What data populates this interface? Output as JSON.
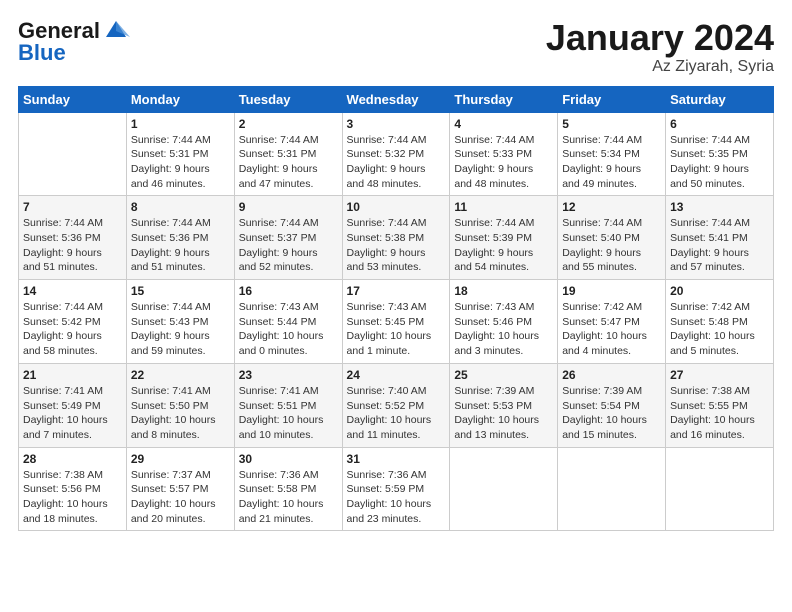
{
  "header": {
    "logo_line1": "General",
    "logo_line2": "Blue",
    "month_title": "January 2024",
    "subtitle": "Az Ziyarah, Syria"
  },
  "days_of_week": [
    "Sunday",
    "Monday",
    "Tuesday",
    "Wednesday",
    "Thursday",
    "Friday",
    "Saturday"
  ],
  "weeks": [
    [
      {
        "day": "",
        "sunrise": "",
        "sunset": "",
        "daylight": ""
      },
      {
        "day": "1",
        "sunrise": "Sunrise: 7:44 AM",
        "sunset": "Sunset: 5:31 PM",
        "daylight": "Daylight: 9 hours and 46 minutes."
      },
      {
        "day": "2",
        "sunrise": "Sunrise: 7:44 AM",
        "sunset": "Sunset: 5:31 PM",
        "daylight": "Daylight: 9 hours and 47 minutes."
      },
      {
        "day": "3",
        "sunrise": "Sunrise: 7:44 AM",
        "sunset": "Sunset: 5:32 PM",
        "daylight": "Daylight: 9 hours and 48 minutes."
      },
      {
        "day": "4",
        "sunrise": "Sunrise: 7:44 AM",
        "sunset": "Sunset: 5:33 PM",
        "daylight": "Daylight: 9 hours and 48 minutes."
      },
      {
        "day": "5",
        "sunrise": "Sunrise: 7:44 AM",
        "sunset": "Sunset: 5:34 PM",
        "daylight": "Daylight: 9 hours and 49 minutes."
      },
      {
        "day": "6",
        "sunrise": "Sunrise: 7:44 AM",
        "sunset": "Sunset: 5:35 PM",
        "daylight": "Daylight: 9 hours and 50 minutes."
      }
    ],
    [
      {
        "day": "7",
        "sunrise": "Sunrise: 7:44 AM",
        "sunset": "Sunset: 5:36 PM",
        "daylight": "Daylight: 9 hours and 51 minutes."
      },
      {
        "day": "8",
        "sunrise": "Sunrise: 7:44 AM",
        "sunset": "Sunset: 5:36 PM",
        "daylight": "Daylight: 9 hours and 51 minutes."
      },
      {
        "day": "9",
        "sunrise": "Sunrise: 7:44 AM",
        "sunset": "Sunset: 5:37 PM",
        "daylight": "Daylight: 9 hours and 52 minutes."
      },
      {
        "day": "10",
        "sunrise": "Sunrise: 7:44 AM",
        "sunset": "Sunset: 5:38 PM",
        "daylight": "Daylight: 9 hours and 53 minutes."
      },
      {
        "day": "11",
        "sunrise": "Sunrise: 7:44 AM",
        "sunset": "Sunset: 5:39 PM",
        "daylight": "Daylight: 9 hours and 54 minutes."
      },
      {
        "day": "12",
        "sunrise": "Sunrise: 7:44 AM",
        "sunset": "Sunset: 5:40 PM",
        "daylight": "Daylight: 9 hours and 55 minutes."
      },
      {
        "day": "13",
        "sunrise": "Sunrise: 7:44 AM",
        "sunset": "Sunset: 5:41 PM",
        "daylight": "Daylight: 9 hours and 57 minutes."
      }
    ],
    [
      {
        "day": "14",
        "sunrise": "Sunrise: 7:44 AM",
        "sunset": "Sunset: 5:42 PM",
        "daylight": "Daylight: 9 hours and 58 minutes."
      },
      {
        "day": "15",
        "sunrise": "Sunrise: 7:44 AM",
        "sunset": "Sunset: 5:43 PM",
        "daylight": "Daylight: 9 hours and 59 minutes."
      },
      {
        "day": "16",
        "sunrise": "Sunrise: 7:43 AM",
        "sunset": "Sunset: 5:44 PM",
        "daylight": "Daylight: 10 hours and 0 minutes."
      },
      {
        "day": "17",
        "sunrise": "Sunrise: 7:43 AM",
        "sunset": "Sunset: 5:45 PM",
        "daylight": "Daylight: 10 hours and 1 minute."
      },
      {
        "day": "18",
        "sunrise": "Sunrise: 7:43 AM",
        "sunset": "Sunset: 5:46 PM",
        "daylight": "Daylight: 10 hours and 3 minutes."
      },
      {
        "day": "19",
        "sunrise": "Sunrise: 7:42 AM",
        "sunset": "Sunset: 5:47 PM",
        "daylight": "Daylight: 10 hours and 4 minutes."
      },
      {
        "day": "20",
        "sunrise": "Sunrise: 7:42 AM",
        "sunset": "Sunset: 5:48 PM",
        "daylight": "Daylight: 10 hours and 5 minutes."
      }
    ],
    [
      {
        "day": "21",
        "sunrise": "Sunrise: 7:41 AM",
        "sunset": "Sunset: 5:49 PM",
        "daylight": "Daylight: 10 hours and 7 minutes."
      },
      {
        "day": "22",
        "sunrise": "Sunrise: 7:41 AM",
        "sunset": "Sunset: 5:50 PM",
        "daylight": "Daylight: 10 hours and 8 minutes."
      },
      {
        "day": "23",
        "sunrise": "Sunrise: 7:41 AM",
        "sunset": "Sunset: 5:51 PM",
        "daylight": "Daylight: 10 hours and 10 minutes."
      },
      {
        "day": "24",
        "sunrise": "Sunrise: 7:40 AM",
        "sunset": "Sunset: 5:52 PM",
        "daylight": "Daylight: 10 hours and 11 minutes."
      },
      {
        "day": "25",
        "sunrise": "Sunrise: 7:39 AM",
        "sunset": "Sunset: 5:53 PM",
        "daylight": "Daylight: 10 hours and 13 minutes."
      },
      {
        "day": "26",
        "sunrise": "Sunrise: 7:39 AM",
        "sunset": "Sunset: 5:54 PM",
        "daylight": "Daylight: 10 hours and 15 minutes."
      },
      {
        "day": "27",
        "sunrise": "Sunrise: 7:38 AM",
        "sunset": "Sunset: 5:55 PM",
        "daylight": "Daylight: 10 hours and 16 minutes."
      }
    ],
    [
      {
        "day": "28",
        "sunrise": "Sunrise: 7:38 AM",
        "sunset": "Sunset: 5:56 PM",
        "daylight": "Daylight: 10 hours and 18 minutes."
      },
      {
        "day": "29",
        "sunrise": "Sunrise: 7:37 AM",
        "sunset": "Sunset: 5:57 PM",
        "daylight": "Daylight: 10 hours and 20 minutes."
      },
      {
        "day": "30",
        "sunrise": "Sunrise: 7:36 AM",
        "sunset": "Sunset: 5:58 PM",
        "daylight": "Daylight: 10 hours and 21 minutes."
      },
      {
        "day": "31",
        "sunrise": "Sunrise: 7:36 AM",
        "sunset": "Sunset: 5:59 PM",
        "daylight": "Daylight: 10 hours and 23 minutes."
      },
      {
        "day": "",
        "sunrise": "",
        "sunset": "",
        "daylight": ""
      },
      {
        "day": "",
        "sunrise": "",
        "sunset": "",
        "daylight": ""
      },
      {
        "day": "",
        "sunrise": "",
        "sunset": "",
        "daylight": ""
      }
    ]
  ]
}
